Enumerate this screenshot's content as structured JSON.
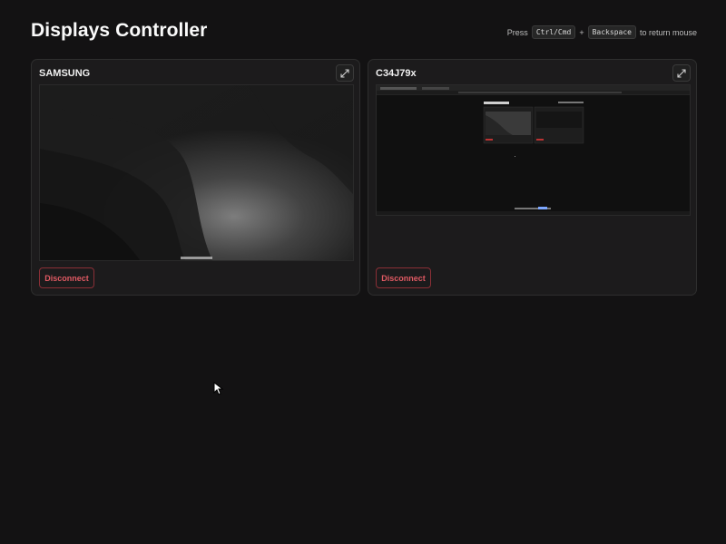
{
  "page": {
    "title": "Displays Controller"
  },
  "hint": {
    "press": "Press",
    "key1": "Ctrl/Cmd",
    "plus": "+",
    "key2": "Backspace",
    "suffix": "to return mouse"
  },
  "displays": [
    {
      "name": "SAMSUNG",
      "disconnect_label": "Disconnect",
      "expand_icon": "expand-icon"
    },
    {
      "name": "C34J79x",
      "disconnect_label": "Disconnect",
      "expand_icon": "expand-icon"
    }
  ],
  "colors": {
    "background": "#131213",
    "card": "#1c1b1c",
    "danger": "#e05a63",
    "danger_border": "#8a2f36"
  }
}
